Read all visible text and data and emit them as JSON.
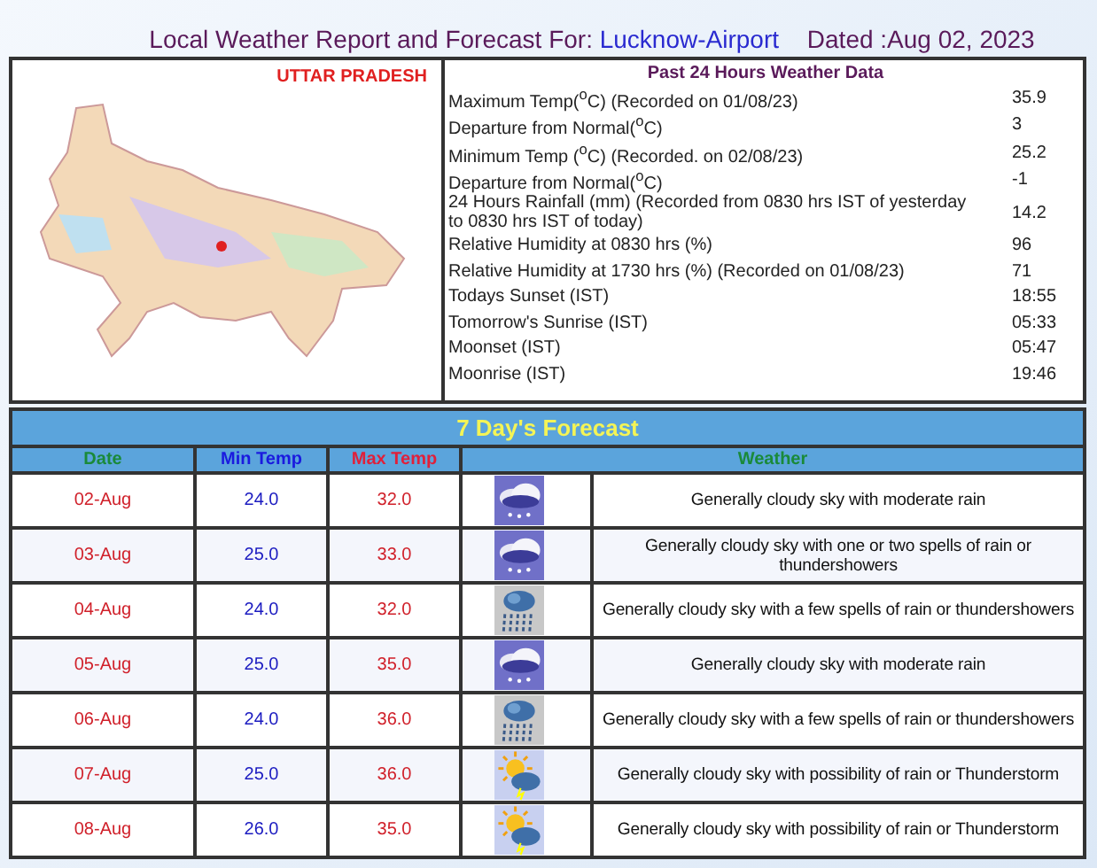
{
  "header": {
    "title": "Local Weather Report and Forecast For:",
    "station": "Lucknow-Airport",
    "dated": "Dated :Aug 02, 2023"
  },
  "map": {
    "title": "UTTAR PRADESH"
  },
  "past_24h": {
    "title": "Past 24 Hours Weather Data",
    "rows": [
      {
        "label": "Maximum Temp($^{o}$C) (Recorded on 01/08/23)",
        "value": "35.9"
      },
      {
        "label": "Departure from Normal($^{o}$C)",
        "value": "3"
      },
      {
        "label": "Minimum Temp ($^{o}$C) (Recorded. on 02/08/23)",
        "value": "25.2"
      },
      {
        "label": "Departure from Normal($^{o}$C)",
        "value": "-1"
      },
      {
        "label": "24 Hours Rainfall (mm) (Recorded from 0830 hrs IST of yesterday to 0830 hrs IST of today)",
        "value": "14.2"
      },
      {
        "label": "Relative Humidity at 0830 hrs (%)",
        "value": "96"
      },
      {
        "label": "Relative Humidity at 1730 hrs (%) (Recorded on 01/08/23)",
        "value": "71"
      },
      {
        "label": "Todays Sunset (IST)",
        "value": "18:55"
      },
      {
        "label": "Tomorrow's Sunrise (IST)",
        "value": "05:33"
      },
      {
        "label": "Moonset (IST)",
        "value": "05:47"
      },
      {
        "label": "Moonrise (IST)",
        "value": "19:46"
      }
    ]
  },
  "forecast": {
    "title": "7 Day's Forecast",
    "columns": [
      "Date",
      "Min Temp",
      "Max Temp",
      "Weather"
    ],
    "rows": [
      {
        "date": "02-Aug",
        "min": "24.0",
        "max": "32.0",
        "kind": "rain",
        "weather": "Generally cloudy sky with moderate rain"
      },
      {
        "date": "03-Aug",
        "min": "25.0",
        "max": "33.0",
        "kind": "rain",
        "weather": "Generally cloudy sky with one or two spells of rain or thundershowers"
      },
      {
        "date": "04-Aug",
        "min": "24.0",
        "max": "32.0",
        "kind": "showers",
        "weather": "Generally cloudy sky with a few spells of rain or thundershowers"
      },
      {
        "date": "05-Aug",
        "min": "25.0",
        "max": "35.0",
        "kind": "rain",
        "weather": "Generally cloudy sky with moderate rain"
      },
      {
        "date": "06-Aug",
        "min": "24.0",
        "max": "36.0",
        "kind": "showers",
        "weather": "Generally cloudy sky with a few spells of rain or thundershowers"
      },
      {
        "date": "07-Aug",
        "min": "25.0",
        "max": "36.0",
        "kind": "sun-storm",
        "weather": "Generally cloudy sky with possibility of rain or Thunderstorm"
      },
      {
        "date": "08-Aug",
        "min": "26.0",
        "max": "35.0",
        "kind": "sun-storm",
        "weather": "Generally cloudy sky with possibility of rain or Thunderstorm"
      }
    ]
  }
}
